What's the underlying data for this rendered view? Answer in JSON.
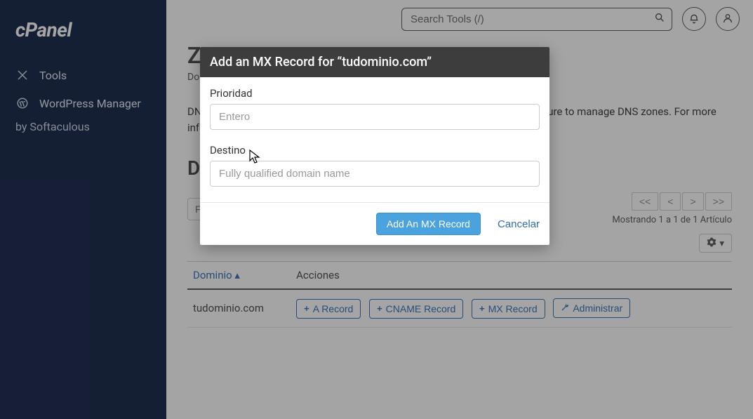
{
  "sidebar": {
    "logo": "cPanel",
    "items": [
      {
        "label": "Tools"
      },
      {
        "label": "WordPress Manager"
      }
    ],
    "sub": "by Softaculous"
  },
  "topbar": {
    "search_placeholder": "Search Tools (/)"
  },
  "page": {
    "title": "Zo",
    "breadcrumb": "Do",
    "desc_pre": "DNS",
    "desc_post": "ure to manage DNS zones. For more info",
    "section": "D",
    "filter_placeholder": "F",
    "pagi_label": "Mostrando 1 a 1 de 1 Artículo"
  },
  "table": {
    "col_domain": "Dominio",
    "col_actions": "Acciones",
    "rows": [
      {
        "domain": "tudominio.com",
        "actions": {
          "a": "A Record",
          "cname": "CNAME Record",
          "mx": "MX Record",
          "admin": "Administrar"
        }
      }
    ]
  },
  "modal": {
    "title": "Add an MX Record for “tudominio.com”",
    "priority_label": "Prioridad",
    "priority_placeholder": "Entero",
    "dest_label": "Destino",
    "dest_placeholder": "Fully qualified domain name",
    "submit": "Add An MX Record",
    "cancel": "Cancelar"
  },
  "pagi": {
    "first": "<<",
    "prev": "<",
    "next": ">",
    "last": ">>"
  }
}
